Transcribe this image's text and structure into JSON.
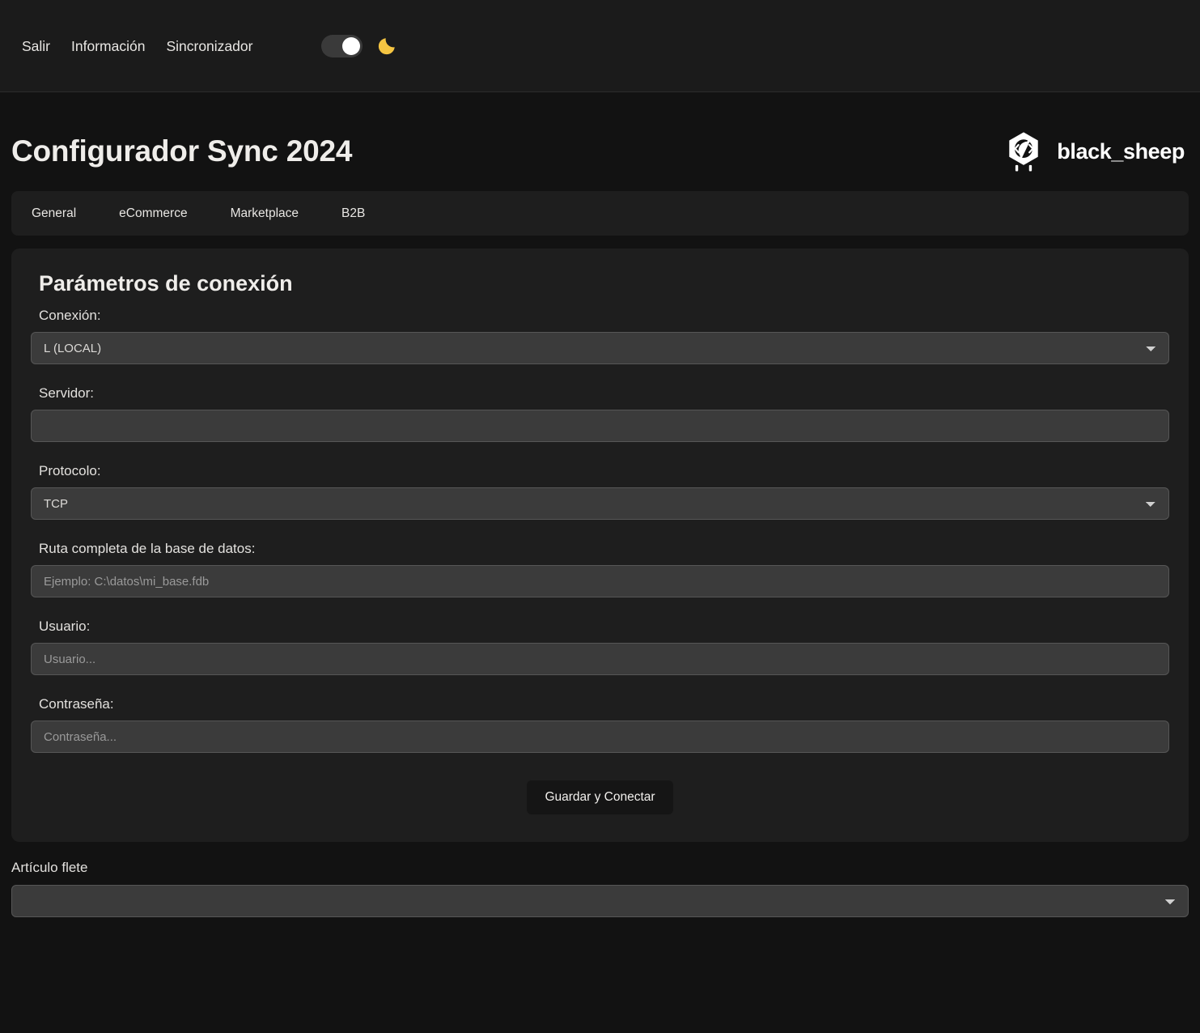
{
  "topnav": {
    "links": [
      {
        "label": "Salir",
        "name": "nav-link-salir"
      },
      {
        "label": "Información",
        "name": "nav-link-informacion"
      },
      {
        "label": "Sincronizador",
        "name": "nav-link-sincronizador"
      }
    ],
    "theme_toggle": {
      "state": "on",
      "icon": "moon-icon",
      "icon_color": "#f5c542"
    }
  },
  "header": {
    "title": "Configurador Sync 2024",
    "brand": {
      "name": "black_sheep",
      "logo_icon": "black-sheep-hex-logo"
    }
  },
  "tabs": [
    {
      "label": "General",
      "name": "tab-general"
    },
    {
      "label": "eCommerce",
      "name": "tab-ecommerce"
    },
    {
      "label": "Marketplace",
      "name": "tab-marketplace"
    },
    {
      "label": "B2B",
      "name": "tab-b2b"
    }
  ],
  "connection_card": {
    "title": "Parámetros de conexión",
    "fields": {
      "conexion": {
        "label": "Conexión:",
        "value": "L (LOCAL)",
        "options": [
          "L (LOCAL)"
        ]
      },
      "servidor": {
        "label": "Servidor:",
        "value": "",
        "placeholder": ""
      },
      "protocolo": {
        "label": "Protocolo:",
        "value": "TCP",
        "options": [
          "TCP"
        ]
      },
      "ruta_bd": {
        "label": "Ruta completa de la base de datos:",
        "value": "",
        "placeholder": "Ejemplo: C:\\datos\\mi_base.fdb"
      },
      "usuario": {
        "label": "Usuario:",
        "value": "",
        "placeholder": "Usuario..."
      },
      "contrasena": {
        "label": "Contraseña:",
        "value": "",
        "placeholder": "Contraseña..."
      }
    },
    "submit_label": "Guardar y Conectar"
  },
  "bottom": {
    "articulo_flete": {
      "label": "Artículo flete",
      "value": "",
      "options": [
        ""
      ]
    }
  },
  "colors": {
    "page_bg": "#121212",
    "surface": "#1e1e1e",
    "nav_bg": "#1b1b1b",
    "input_bg": "#3b3b3b",
    "input_border": "#565656",
    "text": "#e8e6e3",
    "accent_moon": "#f5c542",
    "button_bg": "#151515"
  }
}
